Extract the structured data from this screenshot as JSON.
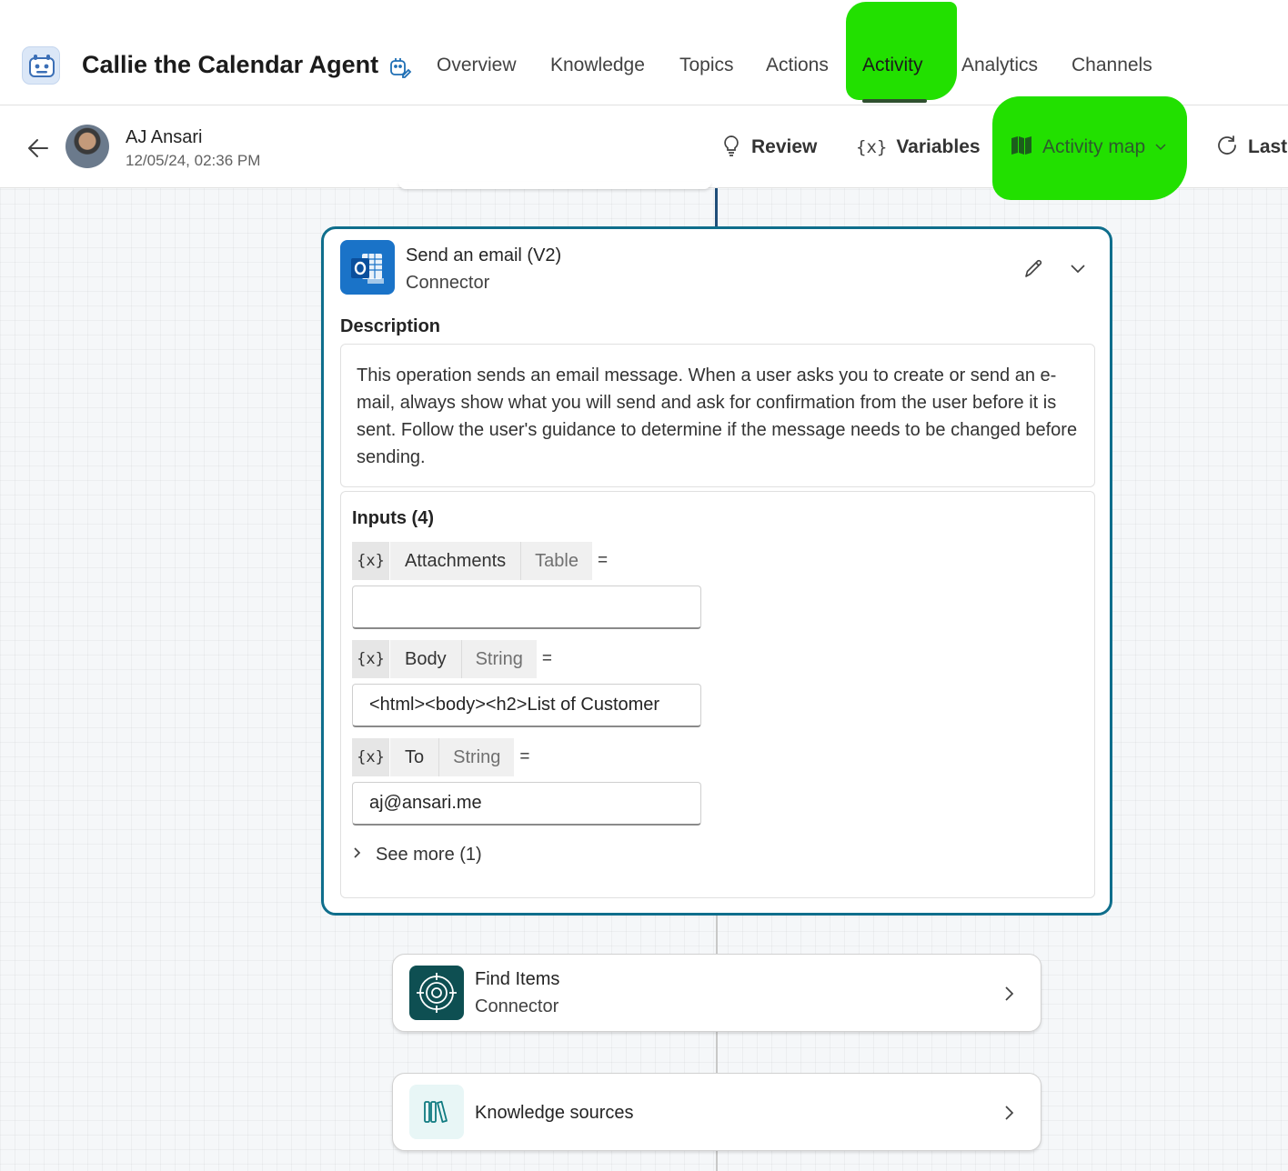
{
  "header": {
    "app_title": "Callie the Calendar Agent",
    "tabs": [
      {
        "label": "Overview"
      },
      {
        "label": "Knowledge"
      },
      {
        "label": "Topics"
      },
      {
        "label": "Actions"
      },
      {
        "label": "Activity",
        "active": true
      },
      {
        "label": "Analytics"
      },
      {
        "label": "Channels"
      }
    ],
    "highlight_color": "#22e000"
  },
  "session": {
    "user_name": "AJ Ansari",
    "timestamp": "12/05/24, 02:36 PM"
  },
  "toolbar": {
    "review_label": "Review",
    "variables_icon_text": "{x}",
    "variables_label": "Variables",
    "activity_map_label": "Activity map",
    "last_label": "Last"
  },
  "action_card": {
    "title": "Send an email (V2)",
    "subtitle": "Connector",
    "accent_color": "#0f6e8c",
    "description_heading": "Description",
    "description": "This operation sends an email message. When a user asks you to create or send an e-mail, always show what you will send and ask for confirmation from the user before it is sent. Follow the user's guidance to determine if the message needs to be changed before sending.",
    "inputs_heading": "Inputs (4)",
    "inputs": [
      {
        "var": "{x}",
        "name": "Attachments",
        "type": "Table",
        "eq": "=",
        "value": ""
      },
      {
        "var": "{x}",
        "name": "Body",
        "type": "String",
        "eq": "=",
        "value": "<html><body><h2>List of Customer"
      },
      {
        "var": "{x}",
        "name": "To",
        "type": "String",
        "eq": "=",
        "value": "aj@ansari.me"
      }
    ],
    "see_more": "See more (1)"
  },
  "steps": [
    {
      "title": "Find Items",
      "subtitle": "Connector",
      "icon": "connector-icon",
      "color": "#0e4f52"
    },
    {
      "title": "Knowledge sources",
      "icon": "books-icon",
      "color": "#e8f6f6"
    }
  ]
}
